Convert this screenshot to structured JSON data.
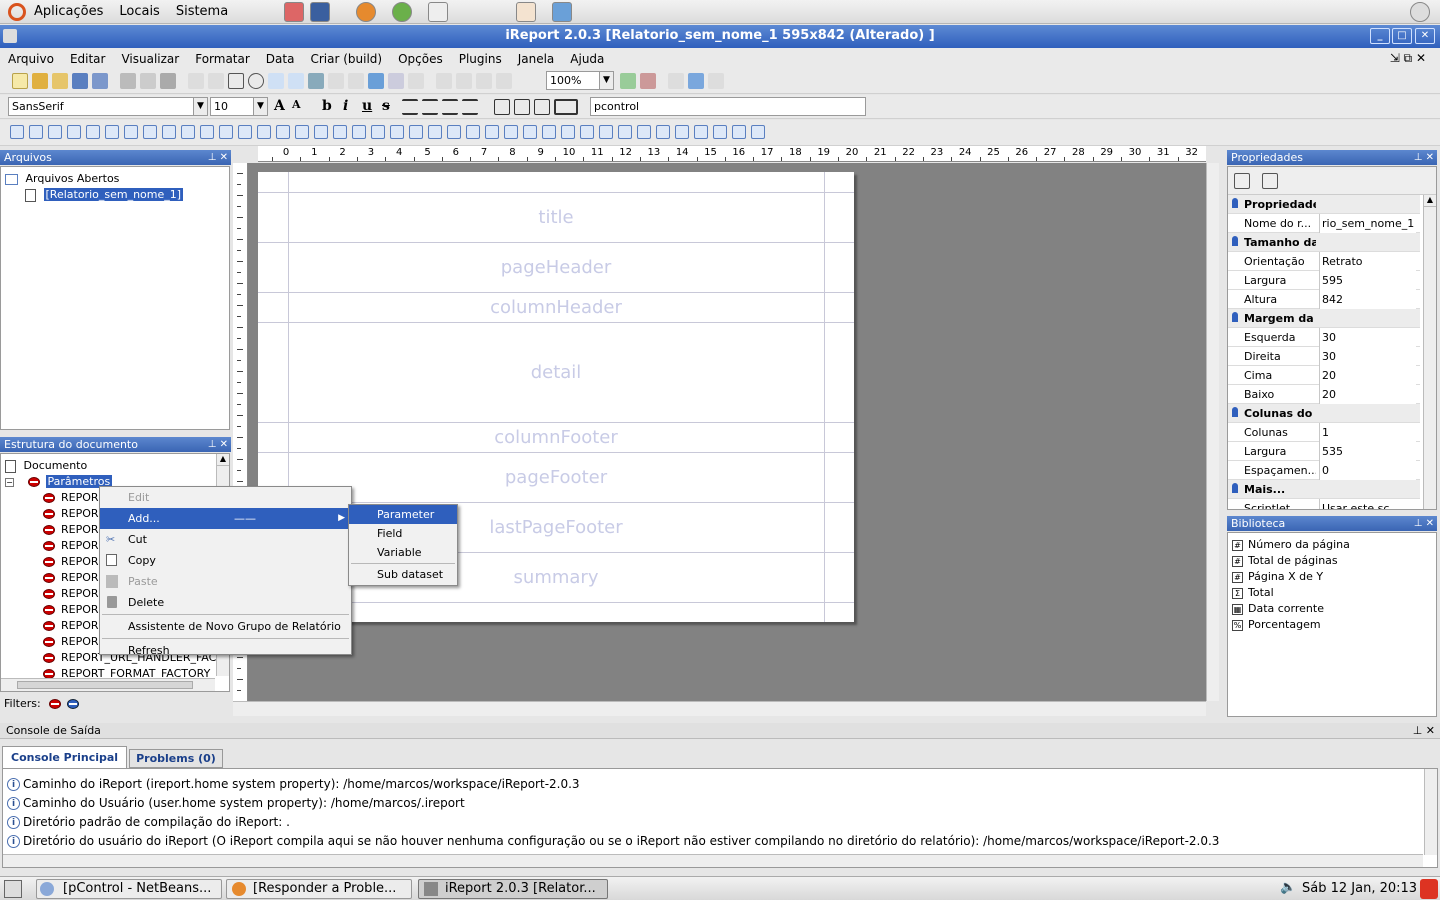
{
  "top_panel": {
    "menus": [
      "Aplicações",
      "Locais",
      "Sistema"
    ]
  },
  "window": {
    "title": "iReport 2.0.3  [Relatorio_sem_nome_1 595x842 (Alterado) ]"
  },
  "menubar": [
    "Arquivo",
    "Editar",
    "Visualizar",
    "Formatar",
    "Data",
    "Criar (build)",
    "Opções",
    "Plugins",
    "Janela",
    "Ajuda"
  ],
  "toolbar": {
    "zoom": "100%",
    "font_family": "SansSerif",
    "font_size": "10",
    "expression": "pcontrol",
    "format_buttons": [
      "b",
      "i",
      "u",
      "s"
    ]
  },
  "files_panel": {
    "title": "Arquivos",
    "root": "Arquivos Abertos",
    "open_file": "[Relatorio_sem_nome_1]"
  },
  "structure_panel": {
    "title": "Estrutura do documento",
    "root": "Documento",
    "parameters_node": "Parâmetros",
    "params": [
      "REPOR",
      "REPOR",
      "REPOR",
      "REPOR",
      "REPOR",
      "REPOR",
      "REPOR",
      "REPOR",
      "REPOR",
      "REPOR",
      "REPORT_URL_HANDLER_FAC",
      "REPORT_FORMAT_FACTORY"
    ],
    "filters_label": "Filters:"
  },
  "context_menu": {
    "edit": "Edit",
    "add": "Add...",
    "cut": "Cut",
    "copy": "Copy",
    "paste": "Paste",
    "delete": "Delete",
    "wizard": "Assistente de Novo Grupo de Relatório",
    "refresh": "Refresh"
  },
  "submenu": {
    "parameter": "Parameter",
    "field": "Field",
    "variable": "Variable",
    "subdataset": "Sub dataset"
  },
  "ruler": {
    "ticks": [
      "0",
      "1",
      "2",
      "3",
      "4",
      "5",
      "6",
      "7",
      "8",
      "9",
      "10",
      "11",
      "12",
      "13",
      "14",
      "15",
      "16",
      "17",
      "18",
      "19",
      "20",
      "21",
      "22",
      "23",
      "24",
      "25",
      "26",
      "27",
      "28",
      "29",
      "30",
      "31",
      "32"
    ]
  },
  "report_bands": [
    "title",
    "pageHeader",
    "columnHeader",
    "detail",
    "columnFooter",
    "pageFooter",
    "lastPageFooter",
    "summary"
  ],
  "properties_panel": {
    "title": "Propriedades",
    "rows": [
      {
        "cat": true,
        "k": "Propriedades",
        "v": ""
      },
      {
        "cat": false,
        "k": "Nome do r...",
        "v": "rio_sem_nome_1"
      },
      {
        "cat": true,
        "k": "Tamanho da",
        "v": ""
      },
      {
        "cat": false,
        "k": "Orientação",
        "v": "Retrato"
      },
      {
        "cat": false,
        "k": "Largura",
        "v": "595"
      },
      {
        "cat": false,
        "k": "Altura",
        "v": "842"
      },
      {
        "cat": true,
        "k": "Margem da p",
        "v": ""
      },
      {
        "cat": false,
        "k": "Esquerda",
        "v": "30"
      },
      {
        "cat": false,
        "k": "Direita",
        "v": "30"
      },
      {
        "cat": false,
        "k": "Cima",
        "v": "20"
      },
      {
        "cat": false,
        "k": "Baixo",
        "v": "20"
      },
      {
        "cat": true,
        "k": "Colunas do r",
        "v": ""
      },
      {
        "cat": false,
        "k": "Colunas",
        "v": "1"
      },
      {
        "cat": false,
        "k": "Largura",
        "v": "535"
      },
      {
        "cat": false,
        "k": "Espaçamen...",
        "v": "0"
      },
      {
        "cat": true,
        "k": "Mais...",
        "v": ""
      },
      {
        "cat": false,
        "k": "Scriptlet",
        "v": "Usar este sc..."
      }
    ]
  },
  "library_panel": {
    "title": "Biblioteca",
    "items": [
      {
        "icon": "#",
        "label": "Número da página"
      },
      {
        "icon": "#",
        "label": "Total de páginas"
      },
      {
        "icon": "#",
        "label": "Página X de Y"
      },
      {
        "icon": "Σ",
        "label": "Total"
      },
      {
        "icon": "▦",
        "label": "Data corrente"
      },
      {
        "icon": "%",
        "label": "Porcentagem"
      }
    ]
  },
  "console": {
    "title": "Console de Saída",
    "tabs": [
      "Console Principal",
      "Problems (0)"
    ],
    "lines": [
      "Caminho do iReport (ireport.home system property): /home/marcos/workspace/iReport-2.0.3",
      "Caminho do Usuário (user.home system property): /home/marcos/.ireport",
      "Diretório padrão de compilação do iReport: .",
      "Diretório do usuário do iReport (O iReport compila aqui se não houver nenhuma configuração ou se o iReport não estiver compilando no diretório do relatório): /home/marcos/workspace/iReport-2.0.3"
    ]
  },
  "taskbar": {
    "tasks": [
      "[pControl - NetBeans...",
      "[Responder a Proble...",
      "iReport 2.0.3  [Relator..."
    ],
    "clock": "Sáb 12 Jan, 20:13"
  }
}
